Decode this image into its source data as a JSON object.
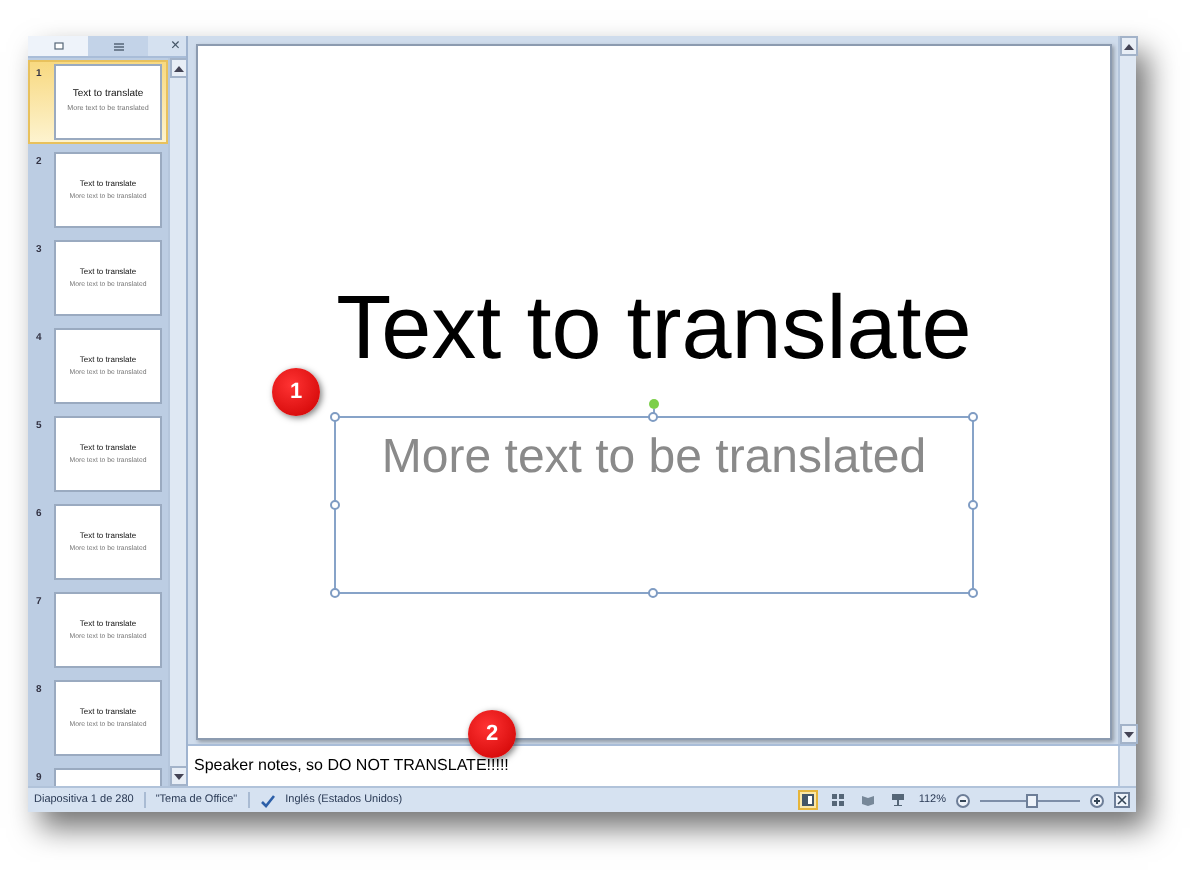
{
  "panel": {
    "tabs": [
      {
        "kind": "slides",
        "selected": true
      },
      {
        "kind": "outline",
        "selected": false
      }
    ],
    "close": "×"
  },
  "thumbnails": [
    {
      "number": "1",
      "title": "Text to translate",
      "subtitle": "More text to be translated",
      "selected": true
    },
    {
      "number": "2",
      "title": "Text to translate",
      "subtitle": "More text to be translated",
      "selected": false
    },
    {
      "number": "3",
      "title": "Text to translate",
      "subtitle": "More text to be translated",
      "selected": false
    },
    {
      "number": "4",
      "title": "Text to translate",
      "subtitle": "More text to be translated",
      "selected": false
    },
    {
      "number": "5",
      "title": "Text to translate",
      "subtitle": "More text to be translated",
      "selected": false
    },
    {
      "number": "6",
      "title": "Text to translate",
      "subtitle": "More text to be translated",
      "selected": false
    },
    {
      "number": "7",
      "title": "Text to translate",
      "subtitle": "More text to be translated",
      "selected": false
    },
    {
      "number": "8",
      "title": "Text to translate",
      "subtitle": "More text to be translated",
      "selected": false
    },
    {
      "number": "9",
      "selected": false
    }
  ],
  "slide": {
    "title": "Text to translate",
    "subtitle": "More text to be translated"
  },
  "notes": "Speaker notes, so DO NOT TRANSLATE!!!!!",
  "callouts": [
    {
      "number": "1"
    },
    {
      "number": "2"
    }
  ],
  "status_bar": {
    "slide_info": "Diapositiva 1 de 280",
    "theme": "\"Tema de Office\"",
    "language": "Inglés (Estados Unidos)",
    "views": [
      {
        "kind": "normal",
        "selected": true
      },
      {
        "kind": "sorter",
        "selected": false
      },
      {
        "kind": "reading",
        "selected": false
      },
      {
        "kind": "show",
        "selected": false
      }
    ],
    "zoom": "112%",
    "zoom_slider": {
      "level": 0.5
    }
  }
}
